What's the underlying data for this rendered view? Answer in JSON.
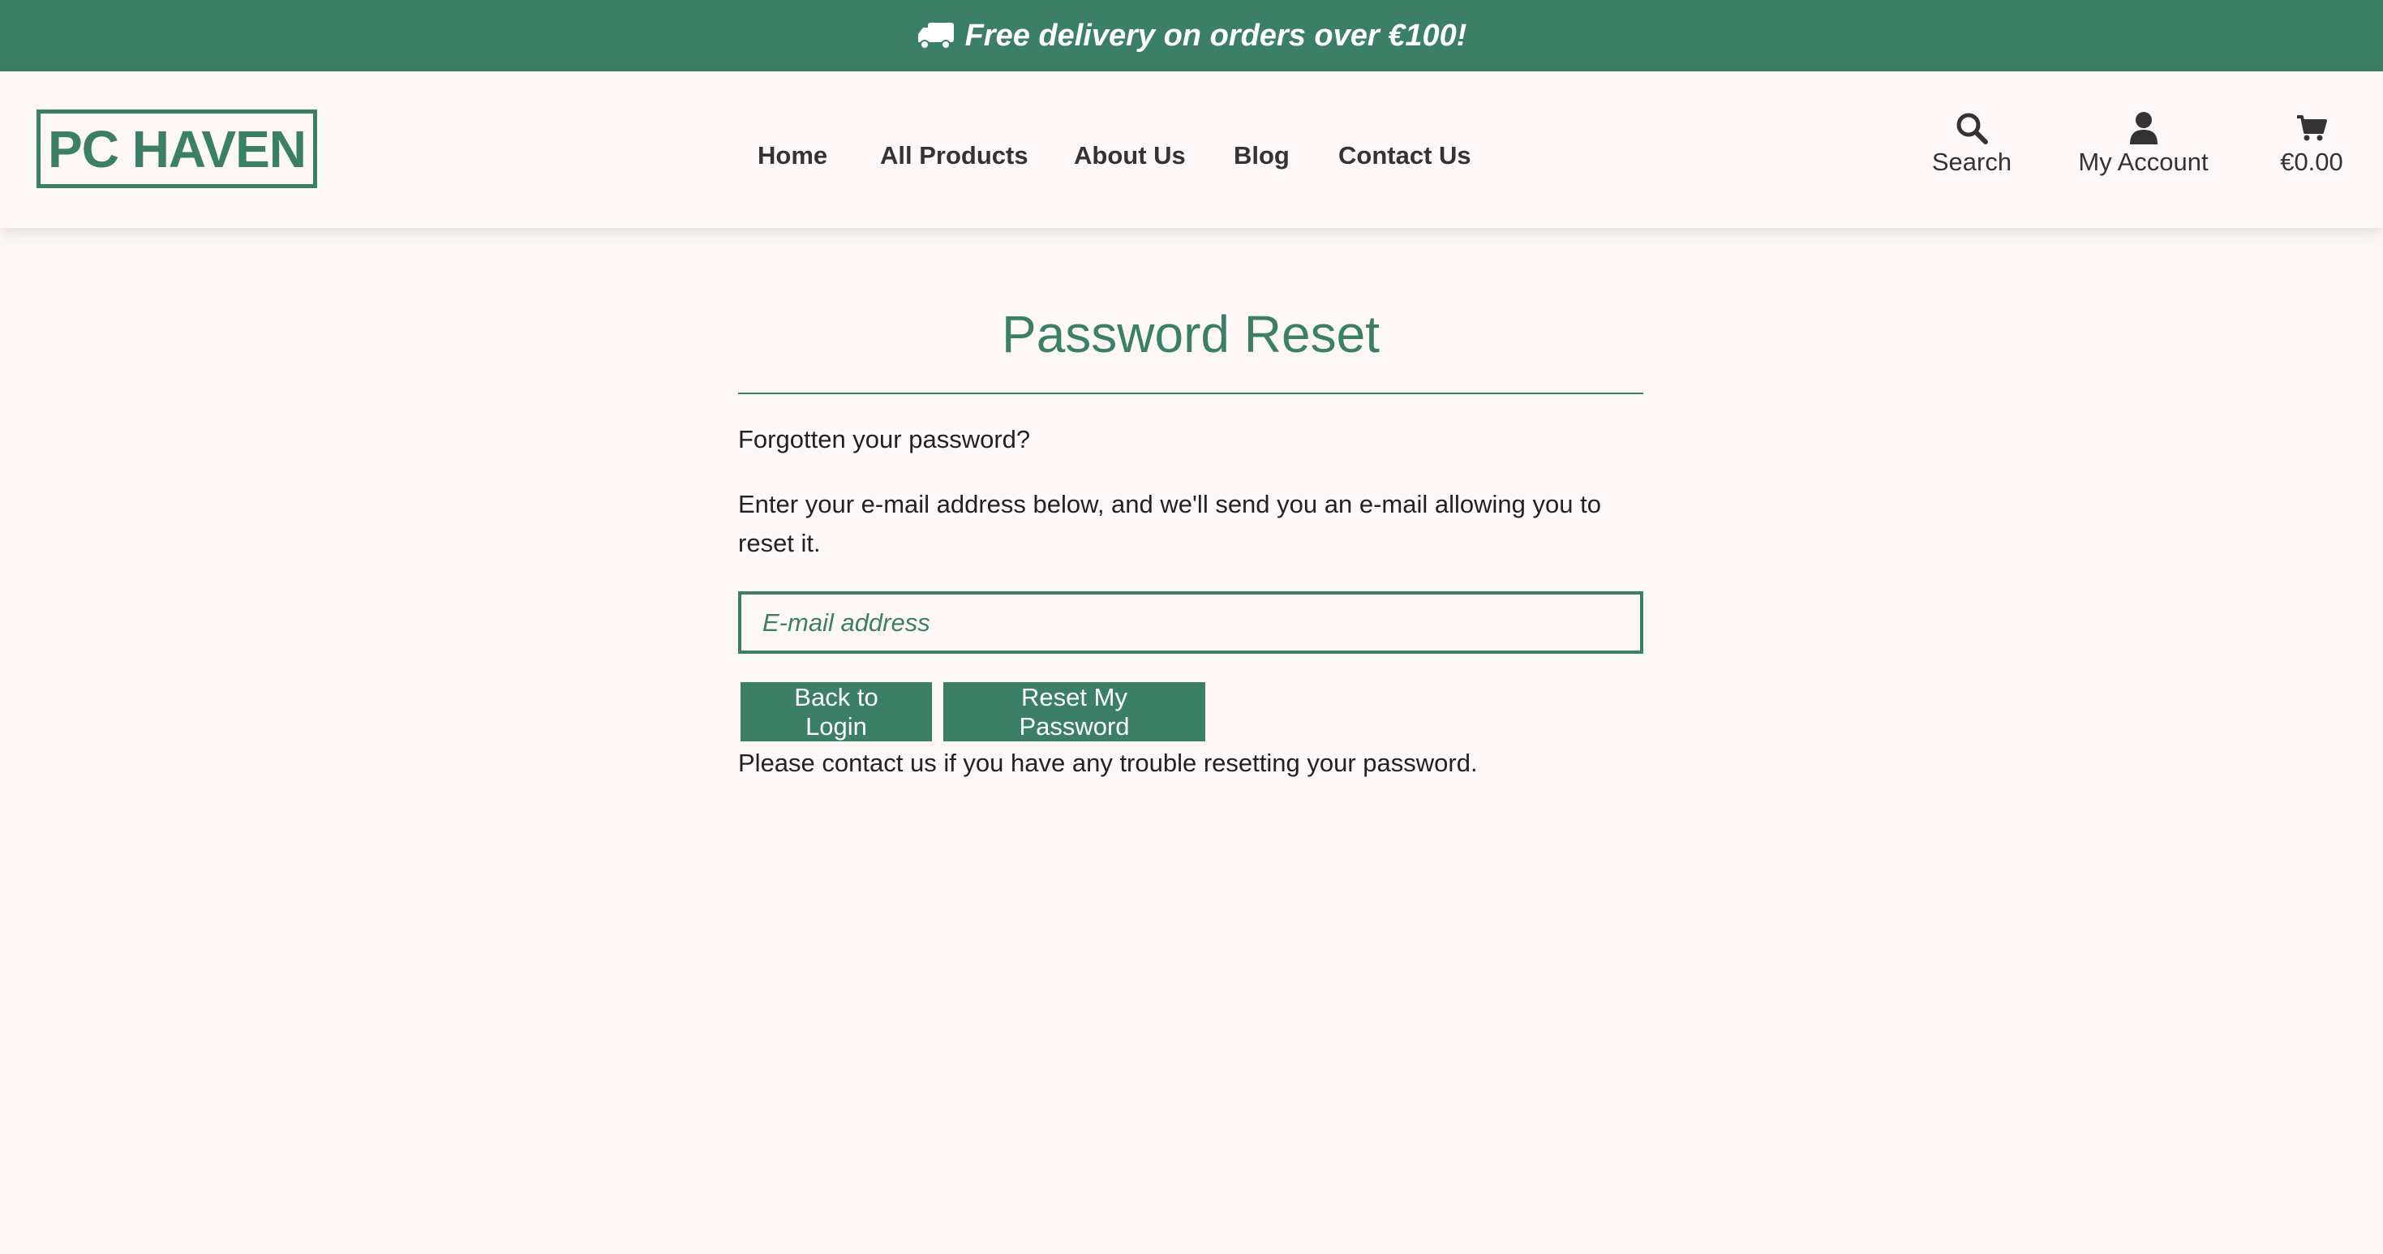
{
  "banner": {
    "icon": "truck-icon",
    "text": "Free delivery on orders over €100!"
  },
  "header": {
    "logo": "PC HAVEN",
    "nav": {
      "home": "Home",
      "all_products": "All Products",
      "about_us": "About Us",
      "blog": "Blog",
      "contact_us": "Contact Us"
    },
    "tools": {
      "search": {
        "icon": "search-icon",
        "label": "Search"
      },
      "account": {
        "icon": "user-icon",
        "label": "My Account"
      },
      "cart": {
        "icon": "cart-icon",
        "label": "€0.00"
      }
    }
  },
  "main": {
    "title": "Password Reset",
    "intro": "Forgotten your password?",
    "instructions": "Enter your e-mail address below, and we'll send you an e-mail allowing you to reset it.",
    "email_placeholder": "E-mail address",
    "email_value": "",
    "back_button": "Back to Login",
    "reset_button": "Reset My Password",
    "footer_note": "Please contact us if you have any trouble resetting your password."
  },
  "colors": {
    "brand": "#3b7f67",
    "background": "#fdf8f7",
    "text": "#222222"
  }
}
